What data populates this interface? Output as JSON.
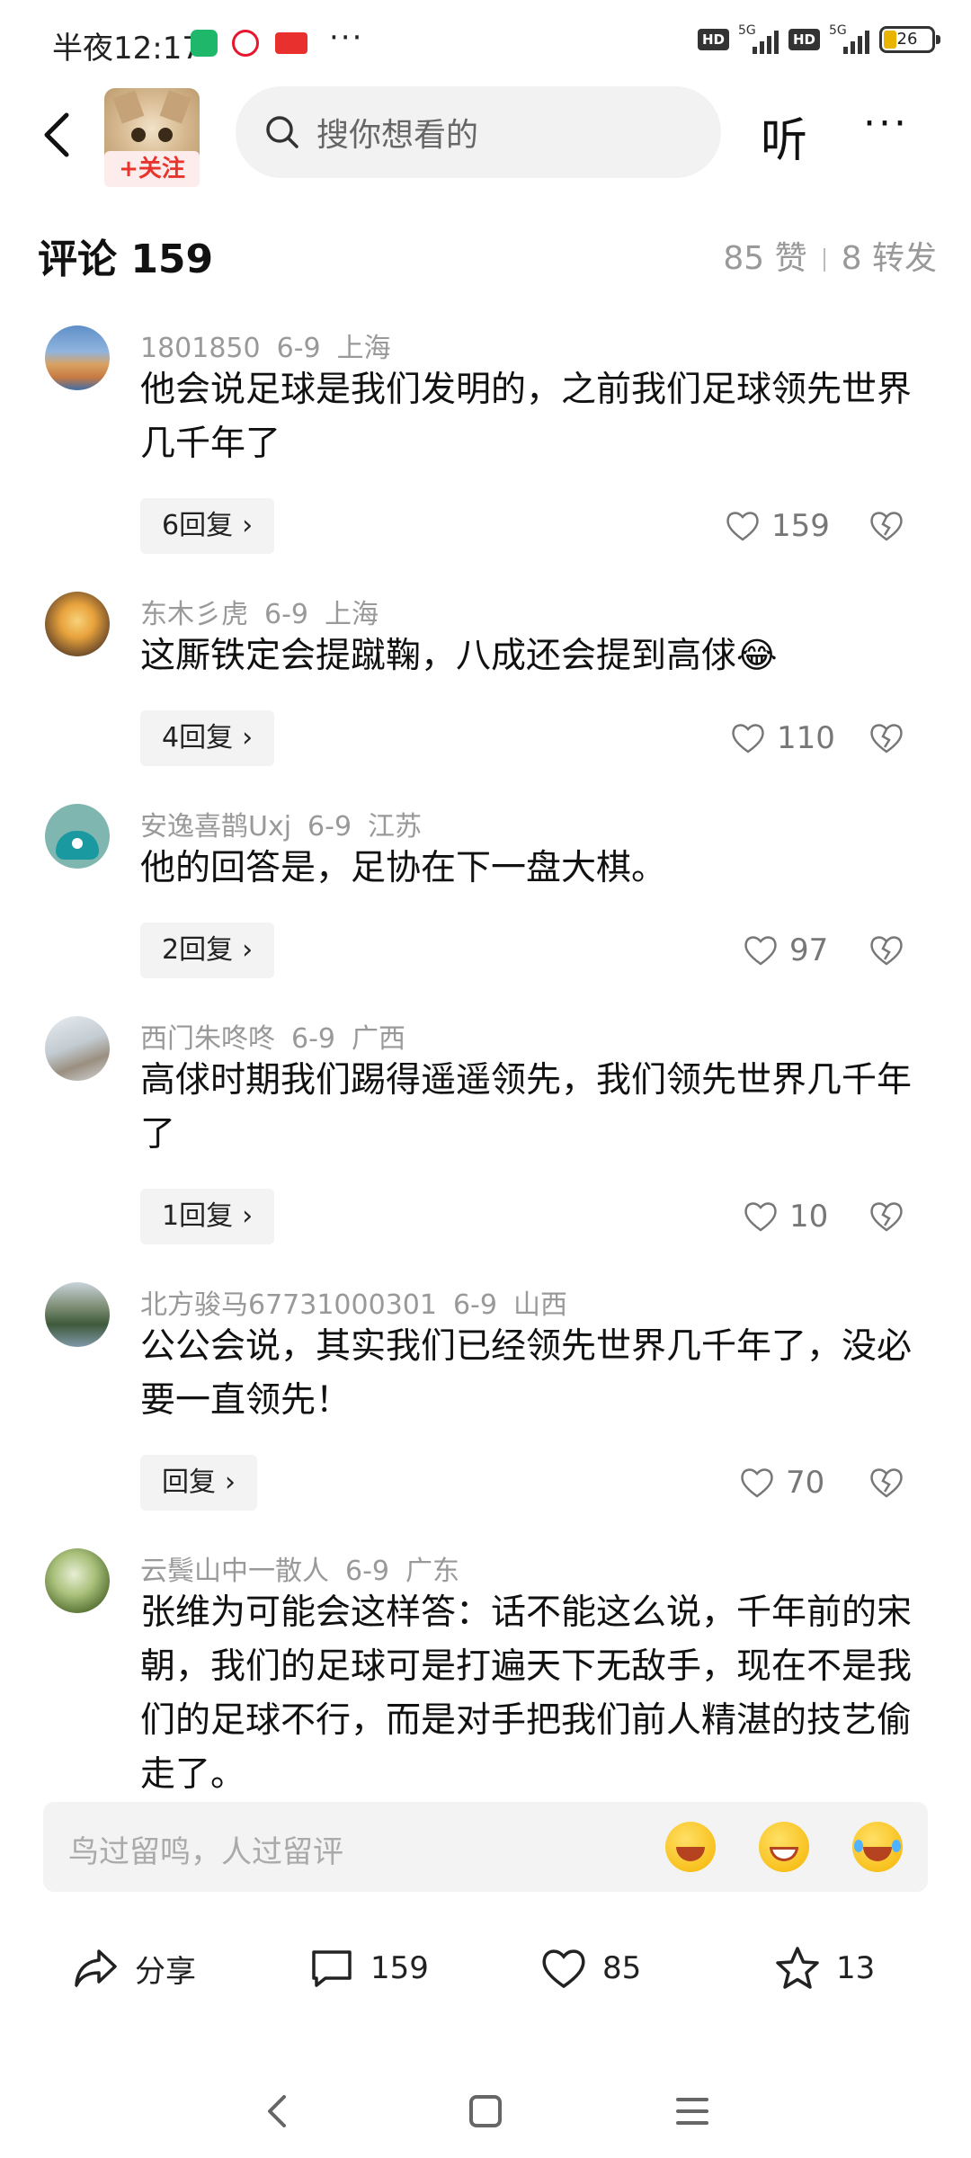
{
  "status_bar": {
    "time": "半夜12:17",
    "more": "···",
    "hd": "HD",
    "net": "5G",
    "battery": "26"
  },
  "header": {
    "follow_label": "+关注",
    "search_placeholder": "搜你想看的",
    "listen_label": "听",
    "more_label": "···"
  },
  "comments_header": {
    "title": "评论 159",
    "likes": "85 赞",
    "shares": "8 转发"
  },
  "comments": [
    {
      "user": "1801850",
      "date": "6-9",
      "location": "上海",
      "text": "他会说足球是我们发明的，之前我们足球领先世界几千年了",
      "replies": "6回复",
      "likes": "159"
    },
    {
      "user": "东木彡虎",
      "date": "6-9",
      "location": "上海",
      "text": "这厮铁定会提蹴鞠，八成还会提到高俅😂",
      "replies": "4回复",
      "likes": "110"
    },
    {
      "user": "安逸喜鹊Uxj",
      "date": "6-9",
      "location": "江苏",
      "text": "他的回答是，足协在下一盘大棋。",
      "replies": "2回复",
      "likes": "97"
    },
    {
      "user": "西门朱咚咚",
      "date": "6-9",
      "location": "广西",
      "text": "高俅时期我们踢得遥遥领先，我们领先世界几千年了",
      "replies": "1回复",
      "likes": "10"
    },
    {
      "user": "北方骏马67731000301",
      "date": "6-9",
      "location": "山西",
      "text": "公公会说，其实我们已经领先世界几千年了，没必要一直领先！",
      "replies": "回复",
      "likes": "70"
    },
    {
      "user": "云鬓山中一散人",
      "date": "6-9",
      "location": "广东",
      "text": "张维为可能会这样答：话不能这么说，千年前的宋朝，我们的足球可是打遍天下无敌手，现在不是我们的足球不行，而是对手把我们前人精湛的技艺偷走了。",
      "replies": "",
      "likes": ""
    }
  ],
  "input": {
    "placeholder": "鸟过留鸣，人过留评"
  },
  "actions": {
    "share": "分享",
    "comments": "159",
    "likes": "85",
    "favorites": "13"
  },
  "colors": {
    "accent_red": "#e7342d",
    "muted_text": "#999999",
    "chip_bg": "#f3f3f3"
  }
}
